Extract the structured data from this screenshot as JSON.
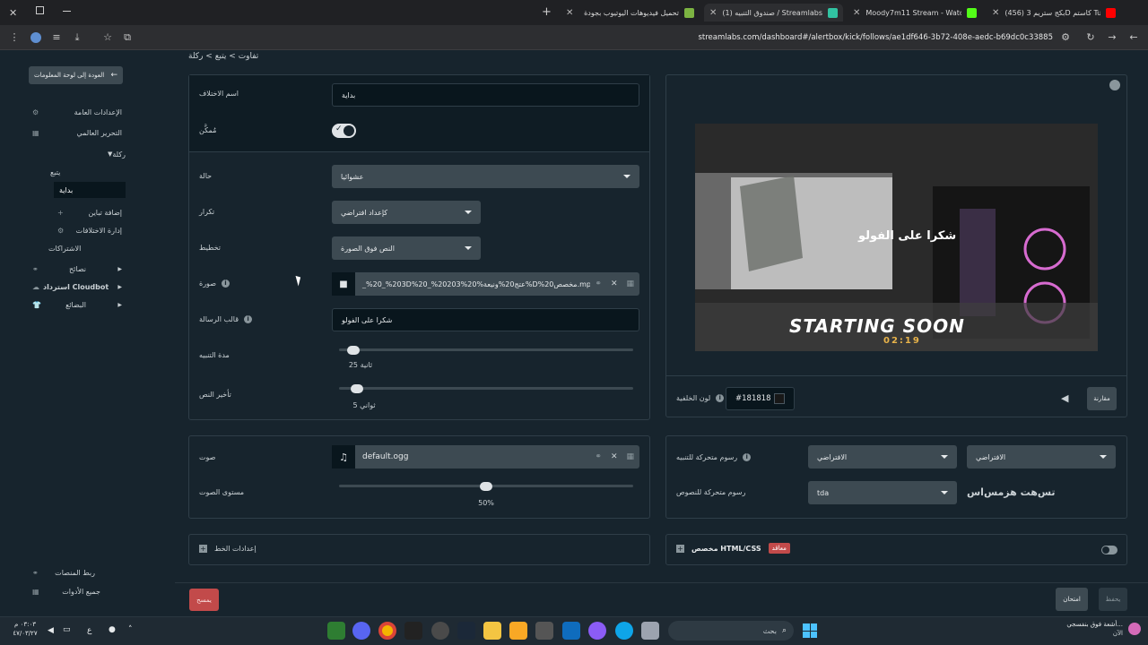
{
  "browser": {
    "tabs": [
      {
        "title": "(456) بكج ستريم 3D كاستم Tube",
        "fav_color": "#ff0000"
      },
      {
        "title": "Moody7m11 Stream - Watch Li",
        "fav_color": "#53fc18"
      },
      {
        "title": "(1) صندوق التنبيه / Streamlabs",
        "fav_color": "#31c3a2"
      },
      {
        "title": "تحميل فيديوهات اليوتيوب بجودة",
        "fav_color": "#7cb342"
      }
    ],
    "new_tab_label": "+",
    "url": "streamlabs.com/dashboard#/alertbox/kick/follows/ae1df646-3b72-408e-aedc-b69dc0c33885"
  },
  "sidebar": {
    "back_button": "العودة إلى لوحة المعلومات",
    "items": [
      {
        "label": "الإعدادات العامة",
        "icon": "gear-icon"
      },
      {
        "label": "التحرير العالمي",
        "icon": "grid-icon"
      },
      {
        "label": "ركلة",
        "icon": "chevron-down-icon"
      },
      {
        "label": "يتبع",
        "icon": ""
      },
      {
        "label": "بداية",
        "icon": ""
      },
      {
        "label": "إضافة تباين",
        "icon": "plus-icon"
      },
      {
        "label": "إدارة الاختلافات",
        "icon": "gear-icon"
      },
      {
        "label": "الاشتراكات",
        "icon": ""
      },
      {
        "label": "نصائح",
        "icon": "link-icon"
      },
      {
        "label": "استرداد Cloudbot",
        "icon": "cloud-icon"
      },
      {
        "label": "البضائع",
        "icon": "shirt-icon"
      }
    ],
    "bottom_items": [
      {
        "label": "ربط المنصات",
        "icon": "link-icon"
      },
      {
        "label": "جميع الأدوات",
        "icon": "grid-icon"
      }
    ]
  },
  "breadcrumb": "تفاوت > يتبع > ركلة",
  "form": {
    "variation_name_label": "اسم الاختلاف",
    "variation_name_value": "بداية",
    "enabled_label": "مُمكَّن",
    "condition_label": "حالة",
    "condition_value": "عشوائيا",
    "repeat_label": "تكرار",
    "repeat_value": "كإعداد افتراضي",
    "layout_label": "تخطيط",
    "layout_value": "النص فوق الصورة",
    "image_label": "صورة",
    "image_value": "_%20_%203D%20_%20203%عتج20%ونيعة%20%D%20مخصص.mp4",
    "message_template_label": "قالب الرسالة",
    "message_template_value": "شكرا على الفولو",
    "alert_duration_label": "مدة التنبيه",
    "alert_duration_value": "25 ثانية",
    "alert_duration_fraction": 0.05,
    "text_delay_label": "تأخير النص",
    "text_delay_value": "5 ثواني",
    "text_delay_fraction": 0.06,
    "sound_label": "صوت",
    "sound_value": "default.ogg",
    "sound_volume_label": "مستوى الصوت",
    "sound_volume_value": "50%",
    "sound_volume_fraction": 0.5,
    "font_settings_label": "إعدادات الخط"
  },
  "preview": {
    "overlay_text": "شكرا على الفولو",
    "banner_text": "STARTING SOON",
    "timer_text": "02:19",
    "compare_button": "مقارنة",
    "bg_color_label": "لون الخلفية",
    "bg_color_value": "#181818"
  },
  "animation": {
    "alert_animation_label": "رسوم متحركة للتنبيه",
    "alert_anim_in": "الافتراضي",
    "alert_anim_out": "الافتراضي",
    "text_animation_label": "رسوم متحركة للنصوص",
    "text_animation_value": "tda",
    "text_animation_sample": "تس‌هت هزمس‌اس"
  },
  "custom": {
    "label": "مخصص HTML/CSS",
    "badge": "معاقد"
  },
  "footer": {
    "delete_button": "يمسح",
    "test_button": "امتحان",
    "save_button": "يحفظ"
  },
  "taskbar": {
    "search_placeholder": "بحث",
    "time": "٠٣:٠٣ م",
    "date": "٤٧/٠٣/٢٧",
    "lang": "ع",
    "notify_title": "أشعة فوق بنفسجي...",
    "notify_sub": "الآن"
  },
  "colors": {
    "page_bg": "#17242d",
    "danger": "#c24a4a",
    "accent": "#31c3a2"
  }
}
